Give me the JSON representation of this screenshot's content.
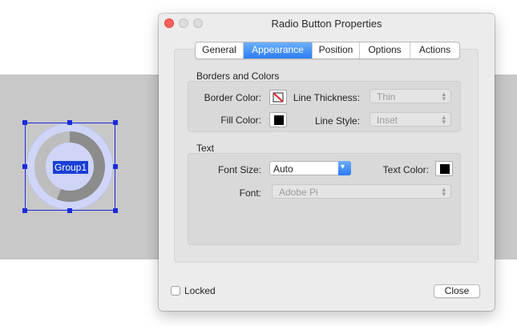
{
  "window": {
    "title": "Radio Button Properties"
  },
  "tabs": [
    {
      "label": "General"
    },
    {
      "label": "Appearance",
      "active": true
    },
    {
      "label": "Position"
    },
    {
      "label": "Options"
    },
    {
      "label": "Actions"
    }
  ],
  "borders_colors": {
    "heading": "Borders and Colors",
    "border_color_label": "Border Color:",
    "fill_color_label": "Fill Color:",
    "line_thickness_label": "Line Thickness:",
    "line_thickness_value": "Thin",
    "line_style_label": "Line Style:",
    "line_style_value": "Inset",
    "fill_color": "#000000",
    "border_color": "none"
  },
  "text_section": {
    "heading": "Text",
    "font_size_label": "Font Size:",
    "font_size_value": "Auto",
    "text_color_label": "Text Color:",
    "text_color": "#000000",
    "font_label": "Font:",
    "font_value": "Adobe Pi"
  },
  "footer": {
    "locked_label": "Locked",
    "locked_checked": false,
    "close_label": "Close"
  },
  "widget": {
    "label": "Group1"
  },
  "colors": {
    "accent": "#2b7cf4",
    "selection": "#1a2bd9",
    "close": "#fc605b"
  }
}
